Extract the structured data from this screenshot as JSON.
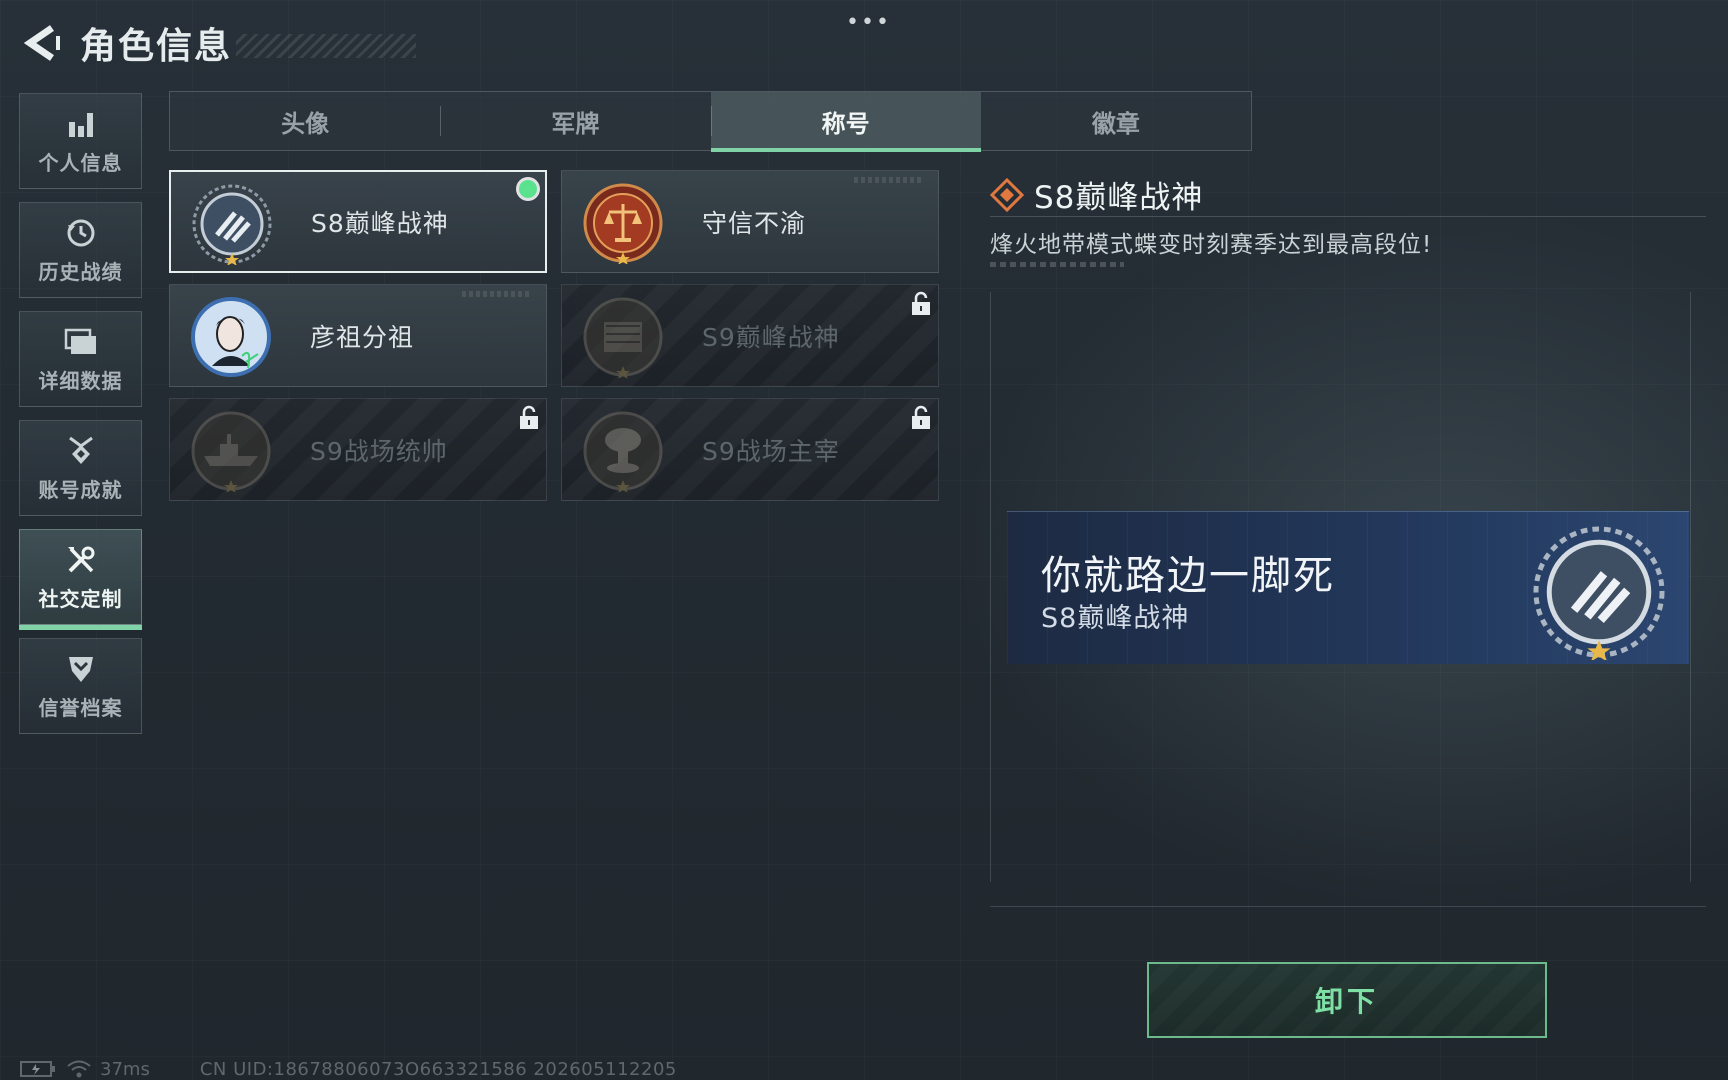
{
  "header": {
    "title": "角色信息",
    "menu_dots": "•••"
  },
  "sidebar": {
    "items": [
      {
        "label": "个人信息",
        "icon": "bar-chart-icon",
        "active": false
      },
      {
        "label": "历史战绩",
        "icon": "history-clock-icon",
        "active": false
      },
      {
        "label": "详细数据",
        "icon": "folder-stack-icon",
        "active": false
      },
      {
        "label": "账号成就",
        "icon": "achievement-medal-icon",
        "active": false
      },
      {
        "label": "社交定制",
        "icon": "tools-wrench-icon",
        "active": true
      },
      {
        "label": "信誉档案",
        "icon": "shield-chevron-icon",
        "active": false
      }
    ]
  },
  "tabs": [
    {
      "label": "头像",
      "active": false
    },
    {
      "label": "军牌",
      "active": false
    },
    {
      "label": "称号",
      "active": true
    },
    {
      "label": "徽章",
      "active": false
    }
  ],
  "titles": [
    {
      "name": "S8巅峰战神",
      "emblem": "crest-emblem-icon",
      "locked": false,
      "selected": true,
      "equipped": true
    },
    {
      "name": "守信不渝",
      "emblem": "scales-emblem-icon",
      "locked": false,
      "selected": false,
      "equipped": false
    },
    {
      "name": "彦祖分祖",
      "emblem": "portrait-emblem-icon",
      "locked": false,
      "selected": false,
      "equipped": false
    },
    {
      "name": "S9巅峰战神",
      "emblem": "building-emblem-icon",
      "locked": true,
      "selected": false,
      "equipped": false
    },
    {
      "name": "S9战场统帅",
      "emblem": "warship-emblem-icon",
      "locked": true,
      "selected": false,
      "equipped": false
    },
    {
      "name": "S9战场主宰",
      "emblem": "mushroom-cloud-emblem-icon",
      "locked": true,
      "selected": false,
      "equipped": false
    }
  ],
  "detail": {
    "title": "S8巅峰战神",
    "description": "烽火地带模式蝶变时刻赛季达到最高段位!"
  },
  "preview": {
    "player_name": "你就路边一脚死",
    "title": "S8巅峰战神"
  },
  "actions": {
    "unequip_label": "卸下"
  },
  "status": {
    "ping": "37ms",
    "uid": "CN UID:18678806073O663321586 202605112205"
  },
  "colors": {
    "accent": "#7fd3a6",
    "equipped": "#5be28e",
    "diamond": "#e0783f"
  }
}
